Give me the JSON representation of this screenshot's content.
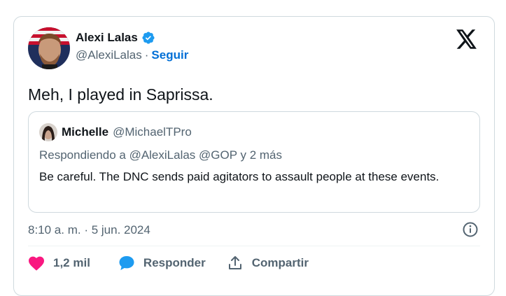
{
  "tweet": {
    "author_name": "Alexi Lalas",
    "author_handle": "@AlexiLalas",
    "separator": "·",
    "follow_label": "Seguir",
    "text": "Meh, I played in Saprissa.",
    "timestamp": "8:10 a. m. · 5 jun. 2024"
  },
  "quote": {
    "author_name": "Michelle",
    "author_handle": "@MichaelTPro",
    "reply_prefix": "Respondiendo a",
    "reply_mentions": "@AlexiLalas @GOP y 2 más",
    "text": "Be careful. The DNC sends paid agitators to assault people at these events."
  },
  "actions": {
    "likes": "1,2 mil",
    "reply_label": "Responder",
    "share_label": "Compartir"
  },
  "icons": {
    "verified": "verified-badge-icon",
    "platform": "x-logo-icon",
    "info": "info-icon",
    "like": "heart-icon",
    "reply": "speech-bubble-icon",
    "share": "share-upload-icon"
  },
  "colors": {
    "verified_blue": "#1d9bf0",
    "follow_blue": "#006fd6",
    "like_pink": "#f91880",
    "secondary_text": "#536471",
    "border": "#cfd9de"
  }
}
